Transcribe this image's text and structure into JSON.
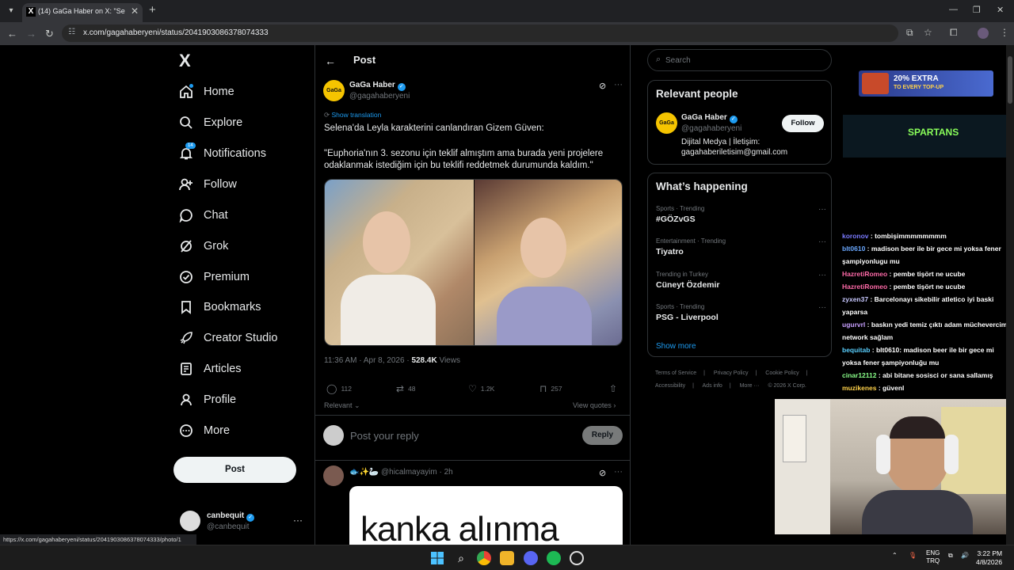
{
  "browser": {
    "tab_title": "(14) GaGa Haber on X: \"Selena'",
    "tab_favicon": "X",
    "url": "x.com/gagahaberyeni/status/2041903086378074333",
    "status_url": "https://x.com/gagahaberyeni/status/2041903086378074333/photo/1"
  },
  "nav": {
    "logo": "X",
    "items": [
      {
        "label": "Home",
        "icon": "home-icon"
      },
      {
        "label": "Explore",
        "icon": "search-icon"
      },
      {
        "label": "Notifications",
        "icon": "bell-icon",
        "badge": "14"
      },
      {
        "label": "Follow",
        "icon": "person-add-icon"
      },
      {
        "label": "Chat",
        "icon": "chat-icon"
      },
      {
        "label": "Grok",
        "icon": "grok-icon"
      },
      {
        "label": "Premium",
        "icon": "premium-icon"
      },
      {
        "label": "Bookmarks",
        "icon": "bookmark-icon"
      },
      {
        "label": "Creator Studio",
        "icon": "rocket-icon"
      },
      {
        "label": "Articles",
        "icon": "article-icon"
      },
      {
        "label": "Profile",
        "icon": "person-icon"
      },
      {
        "label": "More",
        "icon": "more-circle-icon"
      }
    ],
    "post_button": "Post",
    "account": {
      "name": "canbequit",
      "handle": "@canbequit"
    }
  },
  "main": {
    "header_title": "Post",
    "author": {
      "name": "GaGa Haber",
      "handle": "@gagahaberyeni",
      "avatar_text": "GaGa"
    },
    "show_translation": "Show translation",
    "text_line1": "Selena'da Leyla karakterini canlandıran Gizem Güven:",
    "text_line2": "\"Euphoria'nın 3. sezonu için teklif almıştım ama burada yeni projelere odaklanmak istediğim için bu teklifi reddetmek durumunda kaldım.\"",
    "meta": {
      "time": "11:36 AM · Apr 8, 2026 · ",
      "views_count": "528.4K",
      "views_label": " Views"
    },
    "actions": {
      "replies": "112",
      "reposts": "48",
      "likes": "1.2K",
      "bookmarks": "257"
    },
    "sort_label": "Relevant",
    "view_quotes": "View quotes ›",
    "reply_placeholder": "Post your reply",
    "reply_button": "Reply",
    "reply": {
      "name": "🐟✨🦢",
      "handle": "@hicalmayayim · 2h",
      "media_caption": "kanka alınma"
    }
  },
  "right": {
    "search_placeholder": "Search",
    "relevant_people": {
      "title": "Relevant people",
      "name": "GaGa Haber",
      "handle": "@gagahaberyeni",
      "avatar_text": "GaGa",
      "bio": "Dijital Medya | İletişim: gagahaberiletisim@gmail.com",
      "follow": "Follow"
    },
    "happening": {
      "title": "What’s happening",
      "trends": [
        {
          "meta": "Sports · Trending",
          "name": "#GÖZvGS"
        },
        {
          "meta": "Entertainment · Trending",
          "name": "Tiyatro"
        },
        {
          "meta": "Trending in Turkey",
          "name": "Cüneyt Özdemir"
        },
        {
          "meta": "Sports · Trending",
          "name": "PSG - Liverpool"
        }
      ],
      "show_more": "Show more"
    },
    "footer": [
      "Terms of Service",
      "|",
      "Privacy Policy",
      "|",
      "Cookie Policy",
      "|",
      "Accessibility",
      "|",
      "Ads info",
      "|",
      "More ···",
      "© 2026 X Corp."
    ]
  },
  "overlay": {
    "ad_text": "20% EXTRA",
    "ad_sub": "TO EVERY TOP-UP",
    "spartans": "SPARTANS",
    "chat": [
      {
        "user": "koronov",
        "color": "#7a7aff",
        "msg": "tombişimmmmmmmm"
      },
      {
        "user": "blt0610",
        "color": "#6aa8ff",
        "msg": "madison beer ile bir gece mi yoksa fener şampiyonlugu mu"
      },
      {
        "user": "HazretiRomeo",
        "color": "#ff6aa8",
        "msg": "pembe tişört ne ucube"
      },
      {
        "user": "HazretiRomeo",
        "color": "#ff6aa8",
        "msg": "pembe tişört ne ucube"
      },
      {
        "user": "zyxen37",
        "color": "#c8c8ff",
        "msg": "Barcelonayı sikebilir atletico iyi baski yaparsa"
      },
      {
        "user": "ugurvrl",
        "color": "#c8a0ff",
        "msg": "baskın yedi temiz çıktı adam müchevercim network sağlam"
      },
      {
        "user": "bequitab",
        "color": "#5ad0ff",
        "msg": "blt0610: madison beer ile bir gece mi yoksa fener şampiyonluğu mu"
      },
      {
        "user": "cinar12112",
        "color": "#8aff8a",
        "msg": "abi bitane sosisci or sana sallamış"
      },
      {
        "user": "muzikenes",
        "color": "#ffd24a",
        "msg": "güvenl"
      }
    ]
  },
  "taskbar": {
    "lang_line1": "ENG",
    "lang_line2": "TRQ",
    "time": "3:22 PM",
    "date": "4/8/2026"
  }
}
